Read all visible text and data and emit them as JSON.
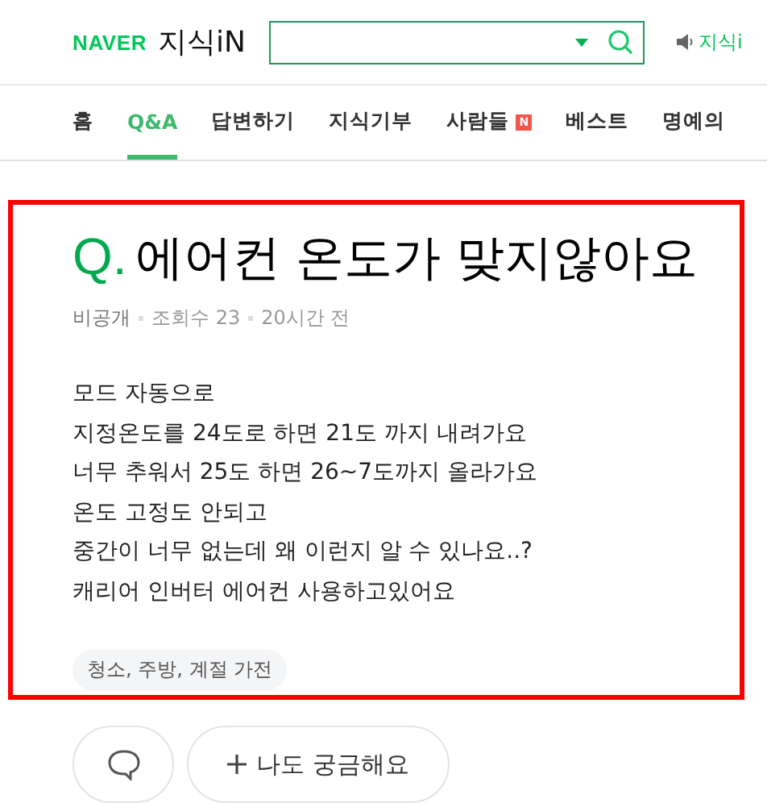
{
  "header": {
    "brand": "NAVER",
    "service": "지식iN",
    "notice": "지식i"
  },
  "nav": [
    {
      "label": "홈",
      "selected": false,
      "new_badge": false
    },
    {
      "label": "Q&A",
      "selected": true,
      "new_badge": false
    },
    {
      "label": "답변하기",
      "selected": false,
      "new_badge": false
    },
    {
      "label": "지식기부",
      "selected": false,
      "new_badge": false
    },
    {
      "label": "사람들",
      "selected": false,
      "new_badge": true,
      "badge": "N"
    },
    {
      "label": "베스트",
      "selected": false,
      "new_badge": false
    },
    {
      "label": "명예의",
      "selected": false,
      "new_badge": false
    }
  ],
  "question": {
    "mark": "Q.",
    "title": "에어컨 온도가 맞지않아요",
    "meta": [
      "비공개",
      "조회수 23",
      "20시간 전"
    ],
    "body": [
      "모드 자동으로",
      "지정온도를 24도로 하면 21도 까지 내려가요",
      "너무 추워서 25도 하면 26~7도까지 올라가요",
      "온도 고정도 안되고",
      "중간이 너무 없는데 왜 이런지 알 수 있나요..?",
      "캐리어 인버터 에어컨 사용하고있어요"
    ],
    "tag": "청소, 주방, 계절 가전"
  },
  "actions": {
    "curious": "나도 궁금해요"
  }
}
